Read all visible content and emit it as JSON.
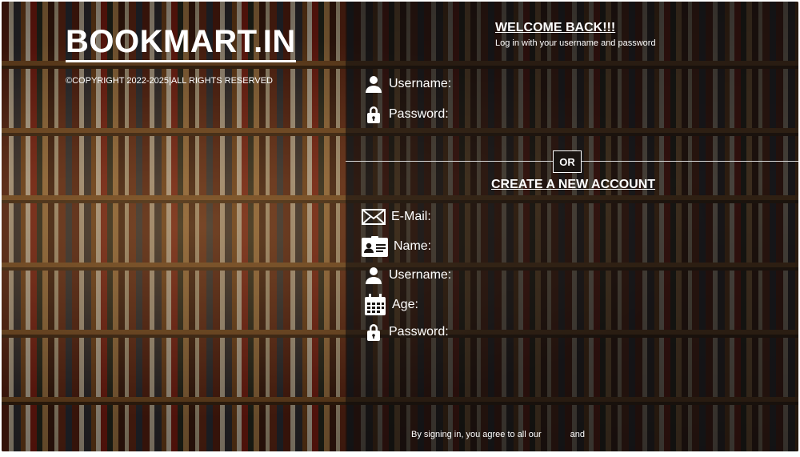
{
  "brand": {
    "title": "BOOKMART.IN",
    "copyright": "©COPYRIGHT 2022-2025|ALL RIGHTS RESERVED"
  },
  "login": {
    "heading": "WELCOME BACK!!!",
    "subheading": "Log in with your username and password",
    "username_label": "Username:",
    "password_label": "Password:"
  },
  "divider": {
    "label": "OR"
  },
  "signup": {
    "heading": "CREATE A NEW ACCOUNT",
    "email_label": "E-Mail:",
    "name_label": "Name:",
    "username_label": "Username:",
    "age_label": "Age:",
    "password_label": "Password:"
  },
  "footer": {
    "terms_prefix": "By signing  in, you agree to all our",
    "terms_and": "and"
  },
  "icons": {
    "user": "user-icon",
    "lock": "lock-icon",
    "mail": "envelope-icon",
    "id": "id-card-icon",
    "calendar": "calendar-icon"
  }
}
